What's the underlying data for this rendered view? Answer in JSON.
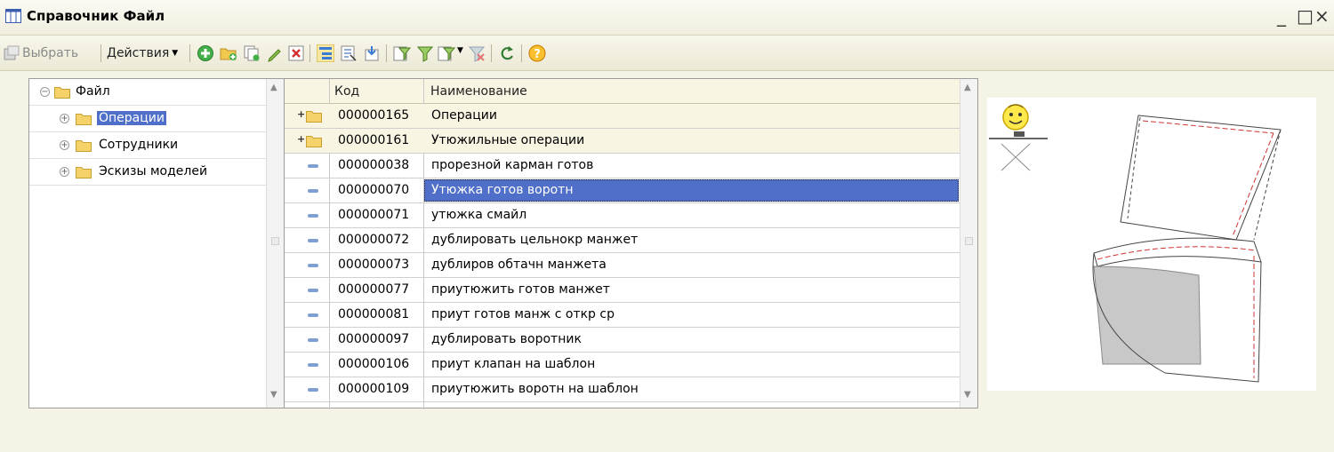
{
  "window": {
    "title": "Справочник Файл",
    "controls": {
      "minimize": "_",
      "maximize": "□",
      "close": "×"
    }
  },
  "toolbar": {
    "select_label": "Выбрать",
    "actions_label": "Действия",
    "icons": [
      "add-icon",
      "add-group-icon",
      "copy-icon",
      "edit-icon",
      "delete-icon",
      "hierarchy-icon",
      "list-mode-icon",
      "move-to-group-icon",
      "filter-icon",
      "filter-by-value-icon",
      "filter-history-icon",
      "clear-filter-icon",
      "refresh-icon",
      "help-icon"
    ]
  },
  "tree": {
    "items": [
      {
        "label": "Файл",
        "expanded": true,
        "level": 0
      },
      {
        "label": "Операции",
        "expanded": false,
        "level": 1,
        "selected": true
      },
      {
        "label": "Сотрудники",
        "expanded": false,
        "level": 1
      },
      {
        "label": "Эскизы моделей",
        "expanded": false,
        "level": 1
      }
    ]
  },
  "grid": {
    "columns": {
      "code": "Код",
      "name": "Наименование"
    },
    "rows": [
      {
        "type": "group",
        "code": "000000165",
        "name": "Операции"
      },
      {
        "type": "group",
        "code": "000000161",
        "name": "Утюжильные операции"
      },
      {
        "type": "item",
        "code": "000000038",
        "name": "прорезной карман готов"
      },
      {
        "type": "item",
        "code": "000000070",
        "name": "Утюжка готов воротн",
        "selected": true
      },
      {
        "type": "item",
        "code": "000000071",
        "name": "утюжка смайл"
      },
      {
        "type": "item",
        "code": "000000072",
        "name": "дублировать цельнокр  манжет"
      },
      {
        "type": "item",
        "code": "000000073",
        "name": "дублиров обтачн манжета"
      },
      {
        "type": "item",
        "code": "000000077",
        "name": "приутюжить готов манжет"
      },
      {
        "type": "item",
        "code": "000000081",
        "name": "приут готов манж с откр ср"
      },
      {
        "type": "item",
        "code": "000000097",
        "name": "дублировать воротник"
      },
      {
        "type": "item",
        "code": "000000106",
        "name": "приут клапан на шаблон"
      },
      {
        "type": "item",
        "code": "000000109",
        "name": "приутюжить воротн на шаблон"
      }
    ]
  },
  "picture": {
    "icons": [
      "smiley-ironing-icon",
      "collar-pattern-sketch"
    ]
  },
  "colors": {
    "selection": "#4f6fc8",
    "group_row": "#f8f5e3",
    "window_bg": "#f5f3e6"
  }
}
